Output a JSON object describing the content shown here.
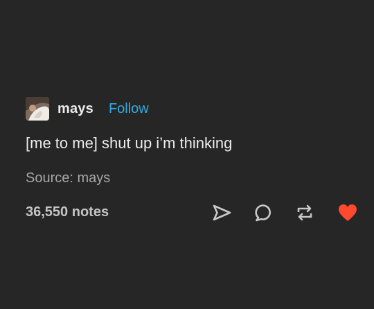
{
  "post": {
    "username": "mays",
    "follow_label": "Follow",
    "body": "[me to me] shut up i’m thinking",
    "source": "Source: mays",
    "notes": "36,550 notes"
  },
  "icons": {
    "share": "share-icon",
    "reply": "reply-icon",
    "reblog": "reblog-icon",
    "like": "heart-icon"
  },
  "colors": {
    "background": "#262626",
    "follow": "#33aadf",
    "like": "#ff492f"
  }
}
